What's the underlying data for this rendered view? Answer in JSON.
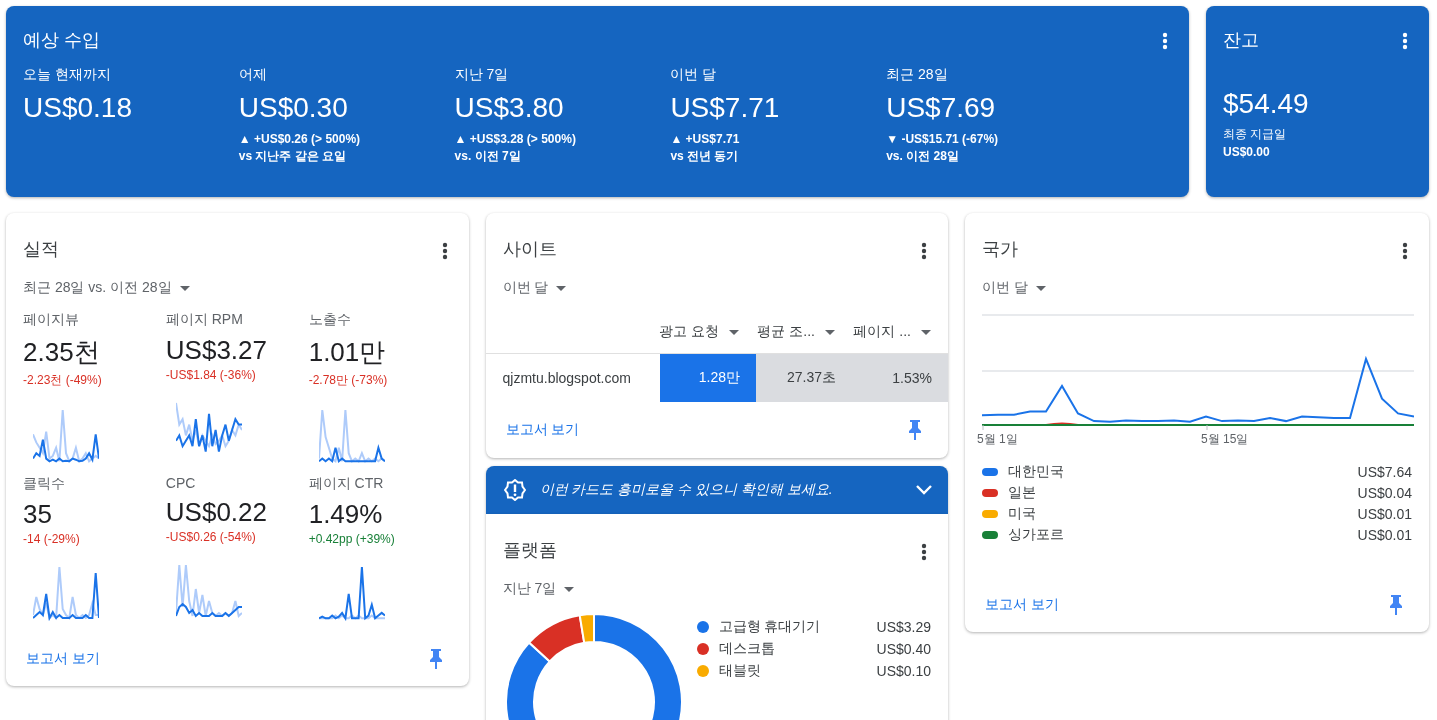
{
  "earnings": {
    "title": "예상 수입",
    "periods": [
      {
        "label": "오늘 현재까지",
        "value": "US$0.18"
      },
      {
        "label": "어제",
        "value": "US$0.30",
        "change": "▲ +US$0.26 (> 500%)",
        "compare": "vs 지난주 같은 요일"
      },
      {
        "label": "지난 7일",
        "value": "US$3.80",
        "change": "▲ +US$3.28 (> 500%)",
        "compare": "vs. 이전 7일"
      },
      {
        "label": "이번 달",
        "value": "US$7.71",
        "change": "▲ +US$7.71",
        "compare": "vs 전년 동기"
      },
      {
        "label": "최근 28일",
        "value": "US$7.69",
        "change": "▼ -US$15.71 (-67%)",
        "compare": "vs. 이전 28일"
      }
    ]
  },
  "balance": {
    "title": "잔고",
    "value": "$54.49",
    "last_payment_label": "최종 지급일",
    "last_payment": "US$0.00"
  },
  "performance": {
    "title": "실적",
    "range": "최근 28일 vs. 이전 28일",
    "metrics": [
      {
        "label": "페이지뷰",
        "value": "2.35천",
        "change": "-2.23천 (-49%)",
        "color": "#d93025"
      },
      {
        "label": "페이지 RPM",
        "value": "US$3.27",
        "change": "-US$1.84 (-36%)",
        "color": "#d93025"
      },
      {
        "label": "노출수",
        "value": "1.01만",
        "change": "-2.78만 (-73%)",
        "color": "#d93025"
      },
      {
        "label": "클릭수",
        "value": "35",
        "change": "-14 (-29%)",
        "color": "#d93025"
      },
      {
        "label": "CPC",
        "value": "US$0.22",
        "change": "-US$0.26 (-54%)",
        "color": "#d93025"
      },
      {
        "label": "페이지 CTR",
        "value": "1.49%",
        "change": "+0.42pp (+39%)",
        "color": "#188038"
      }
    ],
    "report_link": "보고서 보기"
  },
  "sites": {
    "title": "사이트",
    "range": "이번 달",
    "columns": [
      {
        "label": "광고 요청",
        "selected": true
      },
      {
        "label": "평균 조...",
        "selected": false
      },
      {
        "label": "페이지 ...",
        "selected": false
      }
    ],
    "rows": [
      {
        "site": "qjzmtu.blogspot.com",
        "cells": [
          "1.28만",
          "27.37초",
          "1.53%"
        ]
      }
    ],
    "report_link": "보고서 보기"
  },
  "banner": {
    "text": "이런 카드도 흥미로울 수 있으니 확인해 보세요.",
    "expanded": false
  },
  "platforms": {
    "title": "플랫폼",
    "range": "지난 7일",
    "chart_data": {
      "type": "donut",
      "categories": [
        "고급형 휴대기기",
        "데스크톱",
        "태블릿"
      ],
      "values": [
        86.8,
        10.6,
        2.6
      ]
    },
    "legend": [
      {
        "value": "US$3.29",
        "color": "#1a73e8"
      },
      {
        "value": "US$0.40",
        "color": "#d93025"
      },
      {
        "value": "US$0.10",
        "color": "#f9ab00"
      }
    ]
  },
  "countries": {
    "title": "국가",
    "range": "이번 달",
    "x_labels": [
      "5월 1일",
      "5월 15일"
    ],
    "legend": [
      {
        "name": "대한민국",
        "value": "US$7.64",
        "color": "#1a73e8"
      },
      {
        "name": "일본",
        "value": "US$0.04",
        "color": "#d93025"
      },
      {
        "name": "미국",
        "value": "US$0.01",
        "color": "#f9ab00"
      },
      {
        "name": "싱가포르",
        "value": "US$0.01",
        "color": "#188038"
      }
    ],
    "report_link": "보고서 보기"
  }
}
